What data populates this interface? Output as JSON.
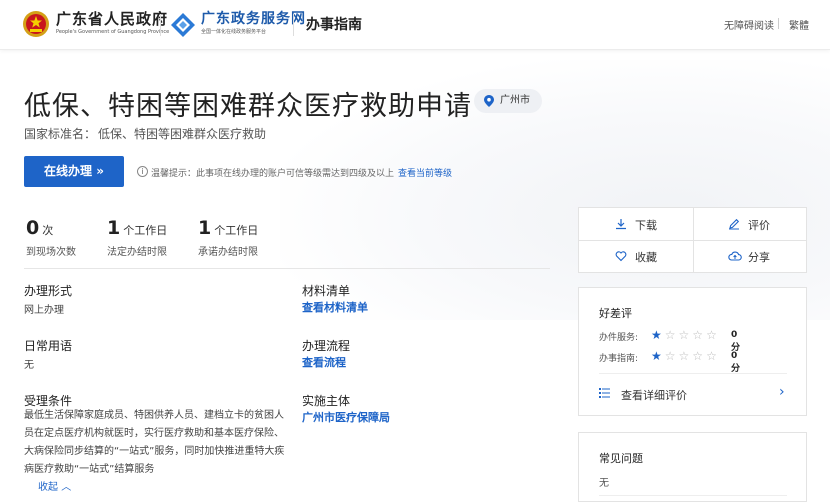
{
  "header": {
    "gov_name": "广东省人民政府",
    "gov_subtitle": "People's Government of Guangdong Province",
    "service_name": "广东政务服务网",
    "service_subtitle": "全国一体化在线政务服务平台",
    "section_title": "办事指南",
    "accessibility_link": "无障碍阅读",
    "traditional_link": "繁體"
  },
  "page": {
    "title": "低保、特困等困难群众医疗救助申请",
    "region": "广州市",
    "standard_name_label": "国家标准名：",
    "standard_name_value": "低保、特困等困难群众医疗救助",
    "online_button": "在线办理 »",
    "tip_text": "温馨提示：此事项在线办理的账户可信等级需达到四级及以上",
    "tip_link": "查看当前等级"
  },
  "stats": [
    {
      "value": "0",
      "unit": "次",
      "label": "到现场次数"
    },
    {
      "value": "1",
      "unit": "个工作日",
      "label": "法定办结时限"
    },
    {
      "value": "1",
      "unit": "个工作日",
      "label": "承诺办结时限"
    }
  ],
  "info": {
    "method_title": "办理形式",
    "method_value": "网上办理",
    "materials_title": "材料清单",
    "materials_link": "查看材料清单",
    "terms_title": "日常用语",
    "terms_value": "无",
    "process_title": "办理流程",
    "process_link": "查看流程",
    "conditions_title": "受理条件",
    "conditions_value": "最低生活保障家庭成员、特困供养人员、建档立卡的贫困人员在定点医疗机构就医时，实行医疗救助和基本医疗保险、大病保险同步结算的“一站式”服务，同时加快推进重特大疾病医疗救助“一站式”结算服务",
    "collapse_label": "收起",
    "entity_title": "实施主体",
    "entity_link": "广州市医疗保障局"
  },
  "actions": {
    "download": "下载",
    "review": "评价",
    "favorite": "收藏",
    "share": "分享"
  },
  "rating": {
    "title": "好差评",
    "service_label": "办件服务:",
    "service_stars": 1,
    "service_score": "0分",
    "guide_label": "办事指南:",
    "guide_stars": 1,
    "guide_score": "0分",
    "detail_link": "查看详细评价"
  },
  "faq": {
    "title": "常见问题",
    "value": "无"
  },
  "colors": {
    "accent": "#1e64c8",
    "brand_dark": "#1d5aaa"
  }
}
